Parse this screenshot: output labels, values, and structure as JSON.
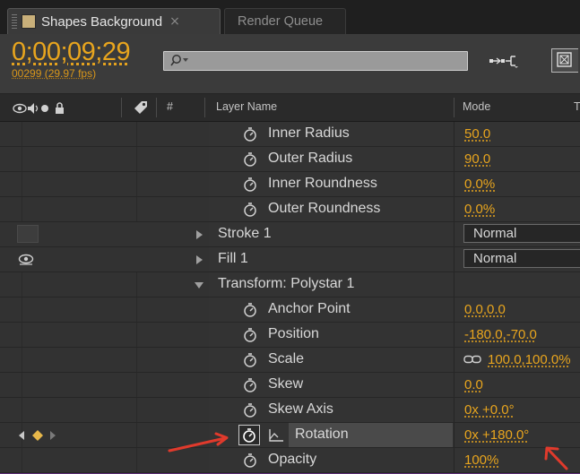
{
  "tabs": [
    {
      "title": "Shapes Background",
      "close": "×",
      "active": true
    },
    {
      "title": "Render Queue",
      "active": false
    }
  ],
  "header": {
    "timecode": "0;00;09;29",
    "frame_fps": "00299 (29.97 fps)",
    "search_placeholder": ""
  },
  "columns": {
    "number": "#",
    "layer_name": "Layer Name",
    "mode": "Mode",
    "t": "T"
  },
  "rows": [
    {
      "type": "property",
      "name": "Inner Radius",
      "value": "50.0"
    },
    {
      "type": "property",
      "name": "Outer Radius",
      "value": "90.0"
    },
    {
      "type": "property",
      "name": "Inner Roundness",
      "value": "0.0%"
    },
    {
      "type": "property",
      "name": "Outer Roundness",
      "value": "0.0%"
    },
    {
      "type": "group",
      "name": "Stroke 1",
      "mode": "Normal"
    },
    {
      "type": "group",
      "name": "Fill 1",
      "mode": "Normal"
    },
    {
      "type": "group",
      "name": "Transform: Polystar 1"
    },
    {
      "type": "property",
      "name": "Anchor Point",
      "value": "0.0,0.0"
    },
    {
      "type": "property",
      "name": "Position",
      "value": "-180.0,-70.0"
    },
    {
      "type": "property",
      "name": "Scale",
      "value": "100.0,100.0%"
    },
    {
      "type": "property",
      "name": "Skew",
      "value": "0.0"
    },
    {
      "type": "property",
      "name": "Skew Axis",
      "value": "0x +0.0°"
    },
    {
      "type": "property",
      "name": "Rotation",
      "value": "0x +180.0°"
    },
    {
      "type": "property",
      "name": "Opacity",
      "value": "100%"
    }
  ],
  "colors": {
    "accent_value": "#e8a51e",
    "annotation_arrow": "#e03a2c",
    "panel_border": "#5a2d74"
  }
}
